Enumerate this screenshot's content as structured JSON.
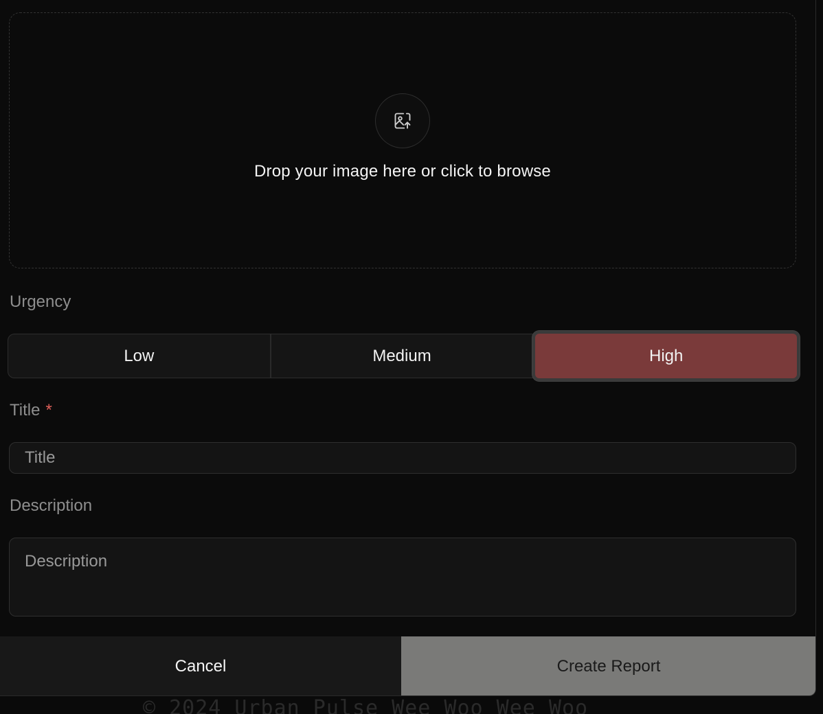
{
  "upload": {
    "icon": "image-upload-icon",
    "text": "Drop your image here or click to browse"
  },
  "urgency": {
    "label": "Urgency",
    "options": [
      "Low",
      "Medium",
      "High"
    ],
    "selected": "High",
    "selected_color": "#7a3a3a"
  },
  "title_field": {
    "label": "Title",
    "required_mark": "*",
    "placeholder": "Title"
  },
  "description_field": {
    "label": "Description",
    "placeholder": "Description"
  },
  "actions": {
    "cancel_label": "Cancel",
    "create_label": "Create Report"
  },
  "footer": {
    "copyright": "© 2024 Urban Pulse  Wee Woo  Wee Woo"
  }
}
